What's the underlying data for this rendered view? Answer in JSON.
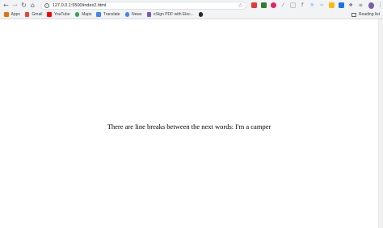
{
  "toolbar": {
    "url": "127.0.0.1:5500/index2.html",
    "back_icon": "arrow-left-icon",
    "forward_icon": "arrow-right-icon",
    "reload_icon": "reload-icon",
    "home_icon": "home-icon",
    "info_icon": "info-icon",
    "bookmark_star_icon": "star-icon",
    "menu_icon": "more-vertical-icon",
    "extensions": [
      {
        "name": "adblock-extension-icon",
        "color": "#e53935"
      },
      {
        "name": "green-extension-icon",
        "color": "#2e7d32"
      },
      {
        "name": "pink-extension-icon",
        "color": "#e91e63"
      },
      {
        "name": "dropper-extension-icon",
        "color": "#5f6368"
      },
      {
        "name": "blank-extension-icon",
        "color": "#bdbdbd"
      },
      {
        "name": "font-extension-icon",
        "color": "#5f6368"
      },
      {
        "name": "react-extension-icon",
        "color": "#1e88e5"
      },
      {
        "name": "wave-extension-icon",
        "color": "#1e88e5"
      },
      {
        "name": "drive-extension-icon",
        "color": "#fbbc04"
      },
      {
        "name": "blue-square-extension-icon",
        "color": "#1a73e8"
      },
      {
        "name": "puzzle-extensions-icon",
        "color": "#5f6368"
      },
      {
        "name": "media-extension-icon",
        "color": "#5f6368"
      }
    ]
  },
  "bookmarks": [
    {
      "label": "Apps",
      "icon": "apps-grid-icon",
      "color": "#e8710a"
    },
    {
      "label": "Gmail",
      "icon": "gmail-icon",
      "color": "#ea4335"
    },
    {
      "label": "YouTube",
      "icon": "youtube-icon",
      "color": "#ff0000"
    },
    {
      "label": "Maps",
      "icon": "maps-icon",
      "color": "#34a853"
    },
    {
      "label": "Translate",
      "icon": "translate-icon",
      "color": "#4285f4"
    },
    {
      "label": "News",
      "icon": "news-icon",
      "color": "#4285f4"
    },
    {
      "label": "eSign PDF with Elec...",
      "icon": "esign-icon",
      "color": "#7e57c2"
    }
  ],
  "bookmark_extra_icon": "github-icon",
  "reading_list": {
    "label": "Reading list",
    "icon": "reading-list-icon"
  },
  "page": {
    "text": "There are line breaks between the next words: I'm a camper"
  }
}
